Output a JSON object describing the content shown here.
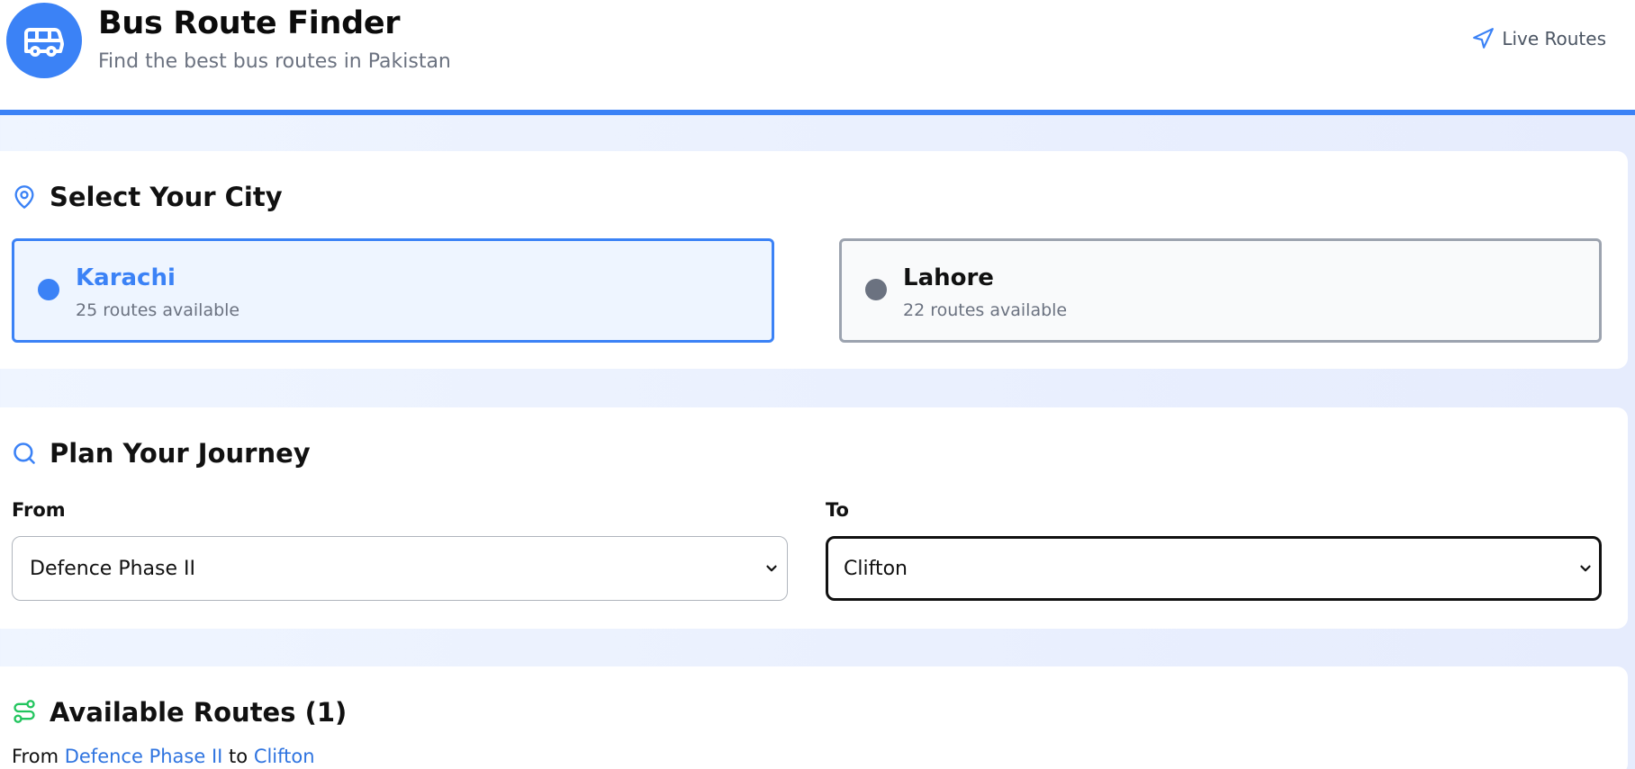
{
  "header": {
    "title": "Bus Route Finder",
    "subtitle": "Find the best bus routes in Pakistan",
    "live_routes_label": "Live Routes",
    "logo_icon": "bus-icon",
    "accent_color": "#3b82f6"
  },
  "city_section": {
    "title": "Select Your City",
    "icon": "map-pin-icon",
    "cities": [
      {
        "name": "Karachi",
        "routes": "25 routes available",
        "selected": true
      },
      {
        "name": "Lahore",
        "routes": "22 routes available",
        "selected": false
      }
    ]
  },
  "journey_section": {
    "title": "Plan Your Journey",
    "icon": "search-icon",
    "from_label": "From",
    "from_value": "Defence Phase II",
    "to_label": "To",
    "to_value": "Clifton"
  },
  "routes_section": {
    "title": "Available Routes (1)",
    "icon": "route-icon",
    "summary_prefix": "From",
    "summary_from": "Defence Phase II",
    "summary_mid": "to",
    "summary_to": "Clifton"
  }
}
